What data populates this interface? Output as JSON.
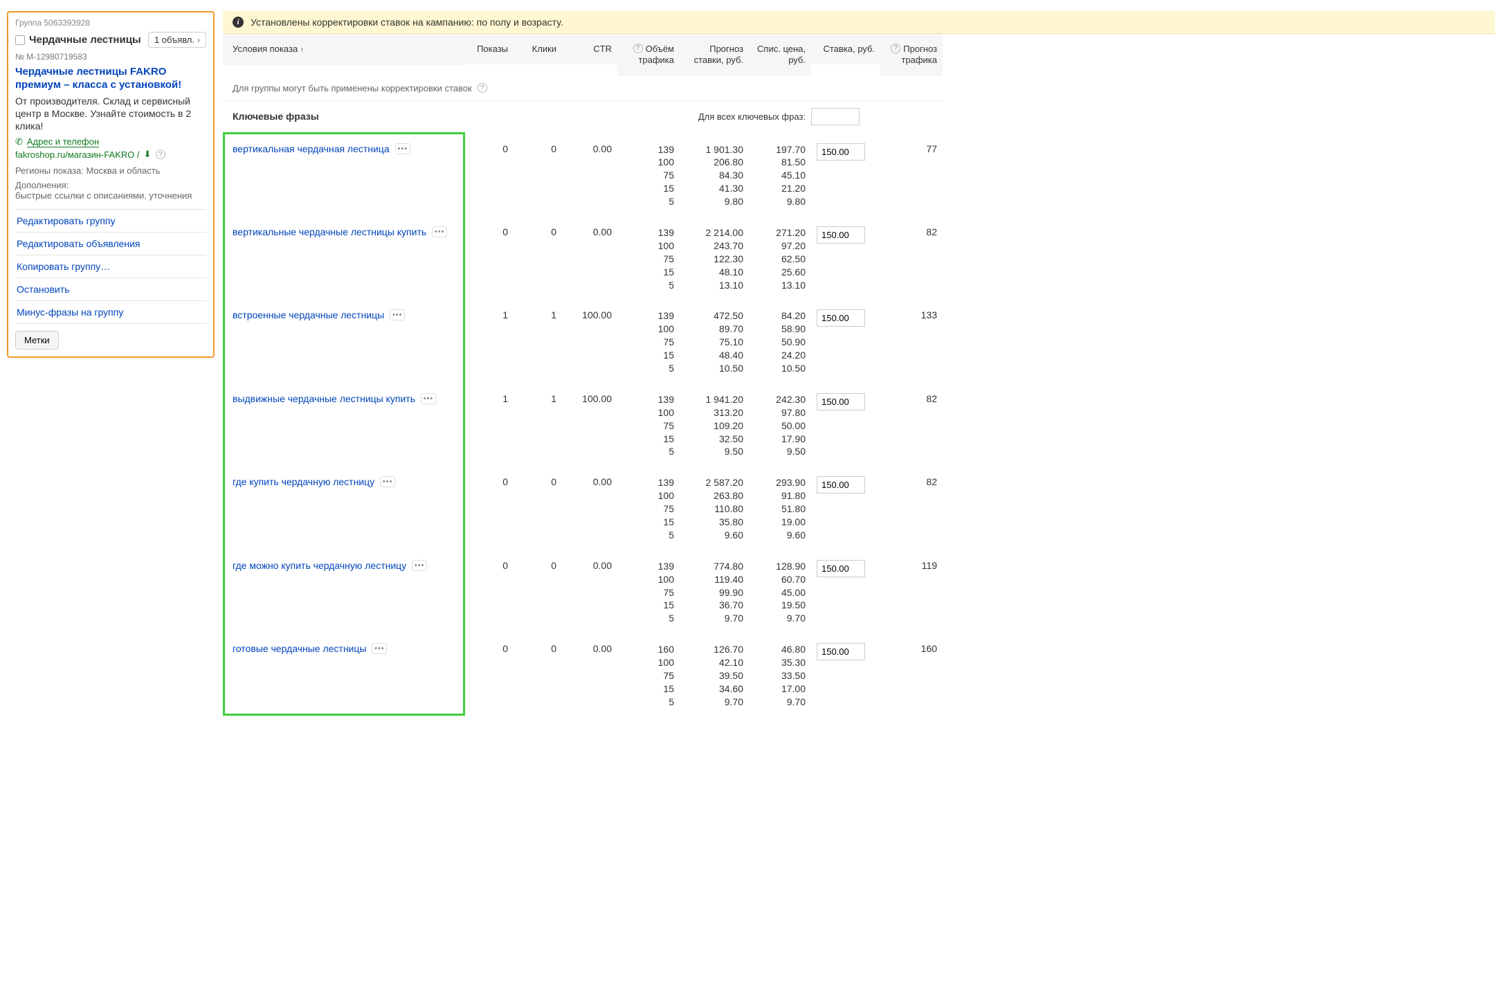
{
  "sidebar": {
    "group_meta": "Группа 5063393928",
    "group_title": "Чердачные лестницы",
    "ad_count_label": "1 объявл.",
    "ad_number": "№ М-12980719583",
    "ad_headline": "Чердачные лестницы FAKRO премиум – класса с установкой!",
    "ad_text": "От производителя. Склад и сервисный центр в Москве. Узнайте стоимость в 2 клика!",
    "address_label": "Адрес и телефон",
    "display_url": "fakroshop.ru/магазин-FAKRO /",
    "regions": "Регионы показа: Москва и область",
    "ext_head": "Дополнения:",
    "ext_body": "быстрые ссылки с описаниями, уточнения",
    "actions": [
      "Редактировать группу",
      "Редактировать объявления",
      "Копировать группу…",
      "Остановить",
      "Минус-фразы на группу"
    ],
    "tags_label": "Метки"
  },
  "banner": "Установлены корректировки ставок на кампанию: по полу и возрасту.",
  "columns": {
    "conditions": "Условия показа",
    "impressions": "Показы",
    "clicks": "Клики",
    "ctr": "CTR",
    "traffic_volume": "Объём трафика",
    "forecast_bid": "Прогноз ставки, руб.",
    "written_price": "Спис. цена, руб.",
    "bid": "Ставка, руб.",
    "traffic_forecast": "Прогноз трафика"
  },
  "corrections_text": "Для группы могут быть применены корректировки ставок",
  "keyword_section_title": "Ключевые фразы",
  "all_bids_label": "Для всех ключевых фраз:",
  "rows": [
    {
      "kw": "вертикальная чердачная лестница",
      "impr": "0",
      "clicks": "0",
      "ctr": "0.00",
      "volumes": "139\n100\n75\n15\n5",
      "forecast": "1 901.30\n206.80\n84.30\n41.30\n9.80",
      "written": "197.70\n81.50\n45.10\n21.20\n9.80",
      "bid": "150.00",
      "forecast_traffic": "77"
    },
    {
      "kw": "вертикальные чердачные лестницы купить",
      "impr": "0",
      "clicks": "0",
      "ctr": "0.00",
      "volumes": "139\n100\n75\n15\n5",
      "forecast": "2 214.00\n243.70\n122.30\n48.10\n13.10",
      "written": "271.20\n97.20\n62.50\n25.60\n13.10",
      "bid": "150.00",
      "forecast_traffic": "82"
    },
    {
      "kw": "встроенные чердачные лестницы",
      "impr": "1",
      "clicks": "1",
      "ctr": "100.00",
      "volumes": "139\n100\n75\n15\n5",
      "forecast": "472.50\n89.70\n75.10\n48.40\n10.50",
      "written": "84.20\n58.90\n50.90\n24.20\n10.50",
      "bid": "150.00",
      "forecast_traffic": "133"
    },
    {
      "kw": "выдвижные чердачные лестницы купить",
      "impr": "1",
      "clicks": "1",
      "ctr": "100.00",
      "volumes": "139\n100\n75\n15\n5",
      "forecast": "1 941.20\n313.20\n109.20\n32.50\n9.50",
      "written": "242.30\n97.80\n50.00\n17.90\n9.50",
      "bid": "150.00",
      "forecast_traffic": "82"
    },
    {
      "kw": "где купить чердачную лестницу",
      "impr": "0",
      "clicks": "0",
      "ctr": "0.00",
      "volumes": "139\n100\n75\n15\n5",
      "forecast": "2 587.20\n263.80\n110.80\n35.80\n9.60",
      "written": "293.90\n91.80\n51.80\n19.00\n9.60",
      "bid": "150.00",
      "forecast_traffic": "82"
    },
    {
      "kw": "где можно купить чердачную лестницу",
      "impr": "0",
      "clicks": "0",
      "ctr": "0.00",
      "volumes": "139\n100\n75\n15\n5",
      "forecast": "774.80\n119.40\n99.90\n36.70\n9.70",
      "written": "128.90\n60.70\n45.00\n19.50\n9.70",
      "bid": "150.00",
      "forecast_traffic": "119"
    },
    {
      "kw": "готовые чердачные лестницы",
      "impr": "0",
      "clicks": "0",
      "ctr": "0.00",
      "volumes": "160\n100\n75\n15\n5",
      "forecast": "126.70\n42.10\n39.50\n34.60\n9.70",
      "written": "46.80\n35.30\n33.50\n17.00\n9.70",
      "bid": "150.00",
      "forecast_traffic": "160"
    }
  ]
}
